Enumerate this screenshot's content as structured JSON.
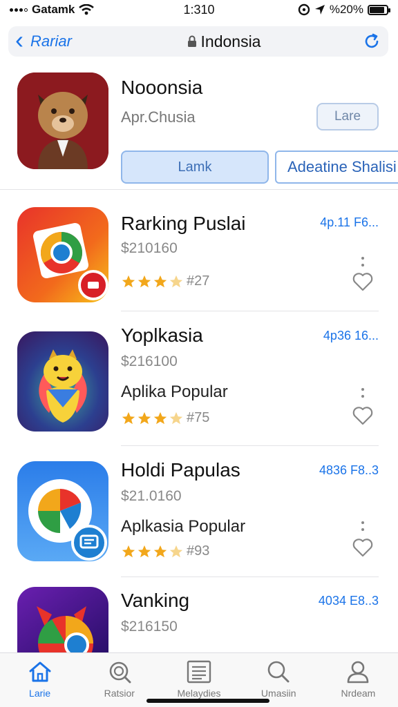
{
  "status": {
    "carrier": "Gatamk",
    "time": "1:310",
    "battery": "%20%"
  },
  "nav": {
    "back_label": "Rariar",
    "title": "Indonsia"
  },
  "featured": {
    "title": "Nooonsia",
    "subtitle": "Apr.Chusia",
    "small_button": "Lare",
    "button_a": "Lamk",
    "button_b": "Adeatine Shalisi"
  },
  "items": [
    {
      "title": "Rarking Puslai",
      "price": "$210160",
      "subtitle": "",
      "rating_label": "#27",
      "rating": 3.5,
      "meta": "4p.11 F6..."
    },
    {
      "title": "Yoplkasia",
      "price": "$216100",
      "subtitle": "Aplika Popular",
      "rating_label": "#75",
      "rating": 3.5,
      "meta": "4p36 16..."
    },
    {
      "title": "Holdi Papulas",
      "price": "$21.0160",
      "subtitle": "Aplkasia Popular",
      "rating_label": "#93",
      "rating": 3.5,
      "meta": "4836 F8..3"
    },
    {
      "title": "Vanking",
      "price": "$216150",
      "subtitle": "",
      "rating_label": "",
      "rating": 0,
      "meta": "4034 E8..3"
    }
  ],
  "tabs": [
    {
      "label": "Larie",
      "icon": "home-icon",
      "active": true
    },
    {
      "label": "Ratsior",
      "icon": "search-badge-icon",
      "active": false
    },
    {
      "label": "Melaydies",
      "icon": "list-icon",
      "active": false
    },
    {
      "label": "Umasiin",
      "icon": "search-icon",
      "active": false
    },
    {
      "label": "Nrdeam",
      "icon": "person-icon",
      "active": false
    }
  ],
  "colors": {
    "accent": "#1a73e8",
    "star": "#f2a71b",
    "star_empty": "#f6d58c"
  }
}
